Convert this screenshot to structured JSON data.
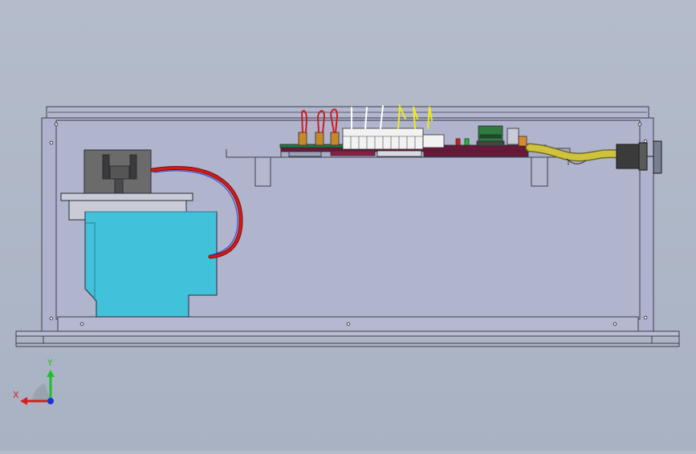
{
  "viewport": {
    "background_color": "#adb6c7",
    "model_view": "front"
  },
  "enclosure": {
    "panel_color": "#aeb2cc",
    "edge_color": "#3d3f4c"
  },
  "components": {
    "motor_pump": {
      "body_color": "#42c2da",
      "head_color": "#6b6b6b"
    },
    "control_board": {
      "pcb_color": "#6b1838"
    },
    "terminal_block": {
      "color": "#f2f2f2"
    },
    "power_cable": {
      "color": "#cfc23c"
    },
    "wires": {
      "red": "#d11b1b",
      "white": "#ffffff",
      "yellow": "#f2ea12",
      "blue": "#2c3bd6"
    }
  },
  "triad": {
    "x_label": "X",
    "y_label": "Y",
    "x_color": "#d51e1e",
    "y_color": "#1fbf2c",
    "z_color": "#1e2fd6",
    "icon": "coordinate-triad-icon"
  }
}
